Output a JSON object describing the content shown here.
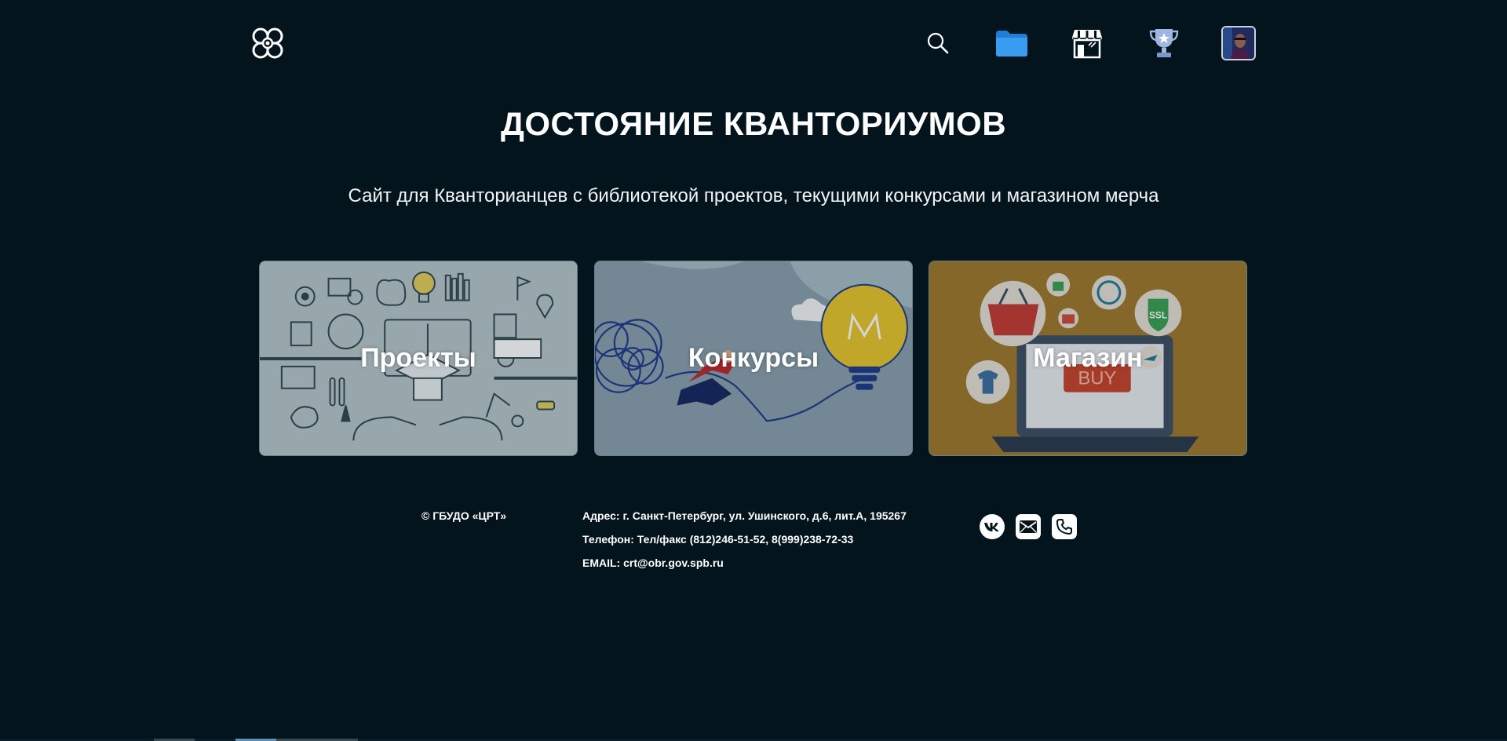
{
  "header": {
    "logo_icon": "kvantorium-logo-icon",
    "nav": [
      {
        "name": "search",
        "icon": "search-icon"
      },
      {
        "name": "projects",
        "icon": "folder-icon",
        "color": "#2a8de0"
      },
      {
        "name": "shop",
        "icon": "storefront-icon"
      },
      {
        "name": "contests",
        "icon": "trophy-icon",
        "color": "#9fb6e0"
      },
      {
        "name": "profile",
        "icon": "avatar"
      }
    ]
  },
  "hero": {
    "title": "ДОСТОЯНИЕ КВАНТОРИУМОВ",
    "subtitle": "Сайт для Кванторианцев с библиотекой проектов, текущими конкурсами и магазином мерча"
  },
  "cards": [
    {
      "label": "Проекты",
      "color": "#b7c6c9"
    },
    {
      "label": "Конкурсы",
      "color": "#8aa0ad"
    },
    {
      "label": "Магазин",
      "color": "#a0792a"
    }
  ],
  "footer": {
    "copyright": "© ГБУДО «ЦРТ»",
    "address": "Адрес: г. Санкт-Петербург, ул. Ушинского, д.6, лит.А, 195267",
    "phone": "Телефон: Тел/факс (812)246-51-52, 8(999)238-72-33",
    "email": "EMAIL: crt@obr.gov.spb.ru",
    "social": [
      {
        "name": "vk",
        "icon": "vk-icon"
      },
      {
        "name": "mail",
        "icon": "mail-icon"
      },
      {
        "name": "phone",
        "icon": "phone-icon"
      }
    ]
  },
  "colors": {
    "background": "#03141c",
    "text": "#ffffff"
  }
}
